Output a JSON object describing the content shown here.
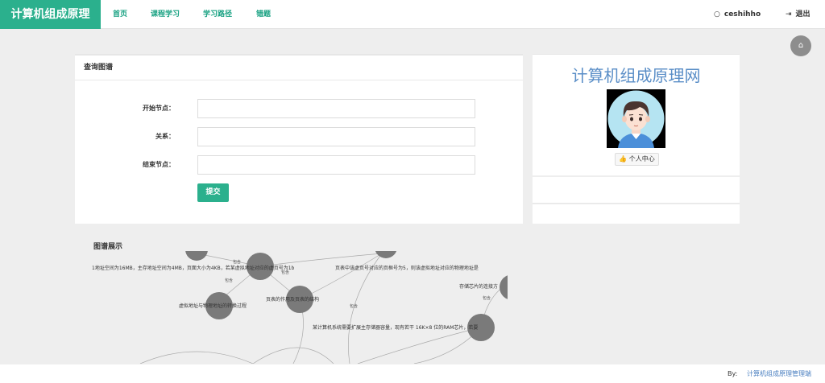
{
  "nav": {
    "brand": "计算机组成原理",
    "links": [
      "首页",
      "课程学习",
      "学习路径",
      "错题"
    ],
    "user": "ceshihho",
    "logout": "退出",
    "user_icon": "user-circle-icon",
    "logout_icon": "sign-out-icon"
  },
  "query": {
    "title": "查询图谱",
    "start_label": "开始节点：",
    "relation_label": "关系：",
    "end_label": "结束节点：",
    "start_value": "",
    "relation_value": "",
    "end_value": "",
    "submit": "提交"
  },
  "profile": {
    "site_name": "计算机组成原理网",
    "user_center": "个人中心",
    "user_center_icon": "thumbs-up-icon"
  },
  "graph": {
    "title": "图谱展示",
    "nodes": [
      {
        "label": "1地址空间为16MB，主存地址空间为4MB，页面大小为4KB，若某虚拟地址对应的虚页号为1b"
      },
      {
        "label": "页表中该虚页号对应的页框号为5，则该虚拟地址对应的物理地址是"
      },
      {
        "label": "虚拟地址与物理地址的转换过程"
      },
      {
        "label": "页表的作用及页表的结构"
      },
      {
        "label": "存储芯片的连接方"
      },
      {
        "label": "某计算机系统需要扩展主存储器容量，现有若干 16K×8 位的RAM芯片，若要"
      }
    ],
    "edge_label": "包含",
    "colors": {
      "node": "#7a7a7a",
      "edge": "#aaaaaa"
    }
  },
  "footer": {
    "by": "By:",
    "admin": "计算机组成原理管理端"
  },
  "colors": {
    "brand": "#2bb08d",
    "link": "#1aa283",
    "site_name": "#5a8ec7"
  }
}
